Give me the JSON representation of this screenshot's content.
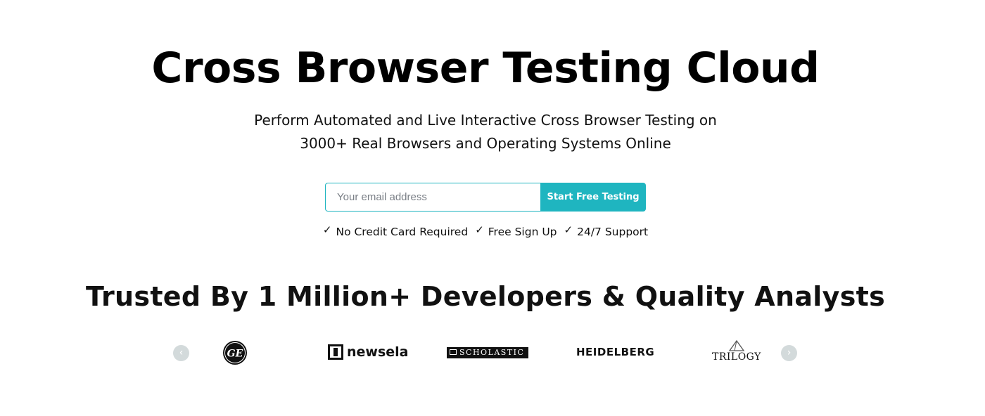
{
  "hero": {
    "title": "Cross Browser Testing Cloud",
    "subtitle_line1": "Perform Automated and Live Interactive Cross Browser Testing on",
    "subtitle_line2": "3000+ Real Browsers and Operating Systems Online"
  },
  "signup": {
    "email_placeholder": "Your email address",
    "email_value": "",
    "button_label": "Start Free Testing"
  },
  "benefits": [
    {
      "icon": "checkmark-icon",
      "label": "No Credit Card Required"
    },
    {
      "icon": "checkmark-icon",
      "label": "Free Sign Up"
    },
    {
      "icon": "checkmark-icon",
      "label": "24/7 Support"
    }
  ],
  "trusted": {
    "heading": "Trusted By 1 Million+ Developers & Quality Analysts"
  },
  "carousel": {
    "prev_icon": "chevron-left-icon",
    "next_icon": "chevron-right-icon",
    "logos": [
      {
        "name": "ge-logo",
        "text": "GE"
      },
      {
        "name": "newsela-logo",
        "text": "newsela"
      },
      {
        "name": "scholastic-logo",
        "text": "SCHOLASTIC"
      },
      {
        "name": "heidelberg-logo",
        "text": "HEIDELBERG"
      },
      {
        "name": "trilogy-logo",
        "text": "TRILOGY"
      }
    ]
  },
  "colors": {
    "accent": "#1fb5c0",
    "arrow_bg": "#d3dadb",
    "text": "#111111"
  }
}
